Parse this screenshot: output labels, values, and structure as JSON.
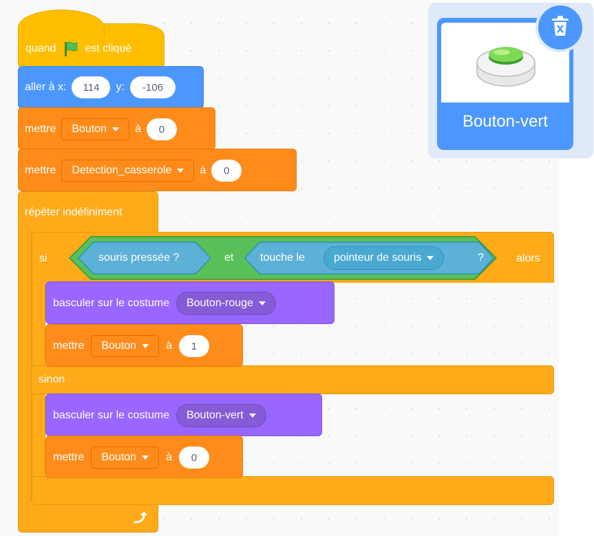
{
  "script": {
    "hat": {
      "label_before": "quand",
      "label_after": "est cliqué",
      "icon": "green-flag-icon"
    },
    "goto": {
      "label": "aller à x:",
      "x_value": "114",
      "y_label": "y:",
      "y_value": "-106"
    },
    "set_bouton": {
      "label": "mettre",
      "variable": "Bouton",
      "to_label": "à",
      "value": "0"
    },
    "set_detection": {
      "label": "mettre",
      "variable": "Detection_casserole",
      "to_label": "à",
      "value": "0"
    },
    "forever": {
      "label": "répéter indéfiniment",
      "loop_icon": "loop-arrow-icon"
    },
    "if_else": {
      "if_label": "si",
      "condition_left": "souris pressée ?",
      "and_label": "et",
      "touching_label": "touche le",
      "touching_target": "pointeur de souris",
      "touching_suffix": "?",
      "then_label": "alors",
      "else_label": "sinon"
    },
    "if_branch": {
      "costume_label": "basculer sur le costume",
      "costume_value": "Bouton-rouge",
      "set_label": "mettre",
      "set_variable": "Bouton",
      "set_to_label": "à",
      "set_value": "1"
    },
    "else_branch": {
      "costume_label": "basculer sur le costume",
      "costume_value": "Bouton-vert",
      "set_label": "mettre",
      "set_variable": "Bouton",
      "set_to_label": "à",
      "set_value": "0"
    }
  },
  "sprite": {
    "name": "Bouton-vert",
    "delete_icon": "trash-icon"
  },
  "colors": {
    "events": "#ffbf00",
    "motion": "#4c97ff",
    "variables": "#ff8c1a",
    "control": "#ffab19",
    "looks": "#9966ff",
    "operators": "#59c059",
    "sensing": "#5cb1d6"
  }
}
